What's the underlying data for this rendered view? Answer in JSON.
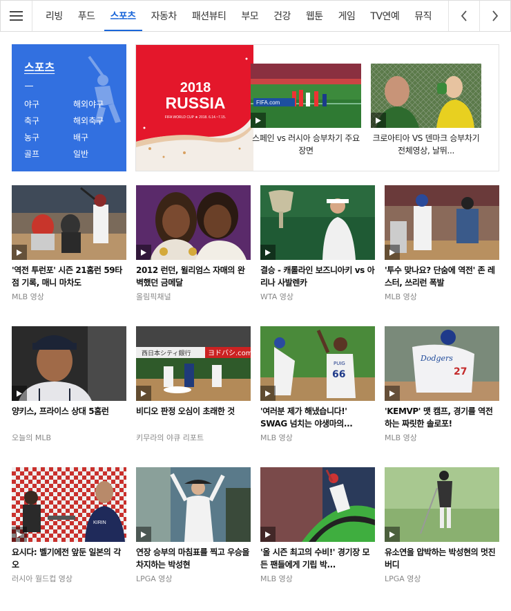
{
  "nav": {
    "tabs": [
      "리빙",
      "푸드",
      "스포츠",
      "자동차",
      "패션뷰티",
      "부모",
      "건강",
      "웹툰",
      "게임",
      "TV연예",
      "뮤직"
    ],
    "active_index": 2,
    "accent": "#1a66d9"
  },
  "category": {
    "title": "스포츠",
    "items": [
      "야구",
      "해외야구",
      "축구",
      "해외축구",
      "농구",
      "배구",
      "골프",
      "일반"
    ],
    "color": "#3270e0"
  },
  "feature": {
    "banner": {
      "year": "2018",
      "name": "RUSSIA",
      "sub": "FIFA WORLD CUP ★ 2018. 6.14.~7.15."
    },
    "items": [
      {
        "caption": "스페인 vs 러시아 승부차기 주요 장면",
        "brand": "FIFA.com"
      },
      {
        "caption": "크로아티아 VS 덴마크 승부차기 전체영상, 날뛰..."
      }
    ]
  },
  "videos": [
    {
      "title": "'역전 투런포' 시즌 21홈런 59타점 기록, 매니 마차도",
      "source": "MLB 영상"
    },
    {
      "title": "2012 런던, 윌리엄스 자매의 완벽했던 금메달",
      "source": "올림픽채널"
    },
    {
      "title": "결승 - 캐롤라인 보즈니아키 vs 아리나 사발렌카",
      "source": "WTA 영상"
    },
    {
      "title": "'투수 맞나요? 단숨에 역전' 존 레스터, 쓰리런 폭발",
      "source": "MLB 영상"
    },
    {
      "title": "양키스, 프라이스 상대 5홈런",
      "source": "오늘의 MLB"
    },
    {
      "title": "비디오 판정 오심이 초래한 것",
      "source": "키무라의 야큐 리포트",
      "signs": [
        "西日本シティ銀行",
        "ヨドバシ.com"
      ]
    },
    {
      "title": "'여러분 제가 해냈습니다!' SWAG 넘치는 야생마의...",
      "source": "MLB 영상",
      "jersey": "66",
      "jersey_name": "PUIG"
    },
    {
      "title": "'KEMVP' 맷 캠프, 경기를 역전하는 짜릿한 솔로포!",
      "source": "MLB 영상",
      "team": "Dodgers",
      "jersey": "27"
    },
    {
      "title": "요시다: 벨기에전 앞둔 일본의 각오",
      "source": "러시아 월드컵 영상",
      "sponsor": "KIRIN"
    },
    {
      "title": "연장 승부의 마침표를 찍고 우승을 차지하는 박성현",
      "source": "LPGA 영상"
    },
    {
      "title": "'올 시즌 최고의 수비!' 경기장 모든 팬들에게 기립 박...",
      "source": "MLB 영상"
    },
    {
      "title": "유소연을 압박하는 박성현의 멋진 버디",
      "source": "LPGA 영상"
    }
  ]
}
